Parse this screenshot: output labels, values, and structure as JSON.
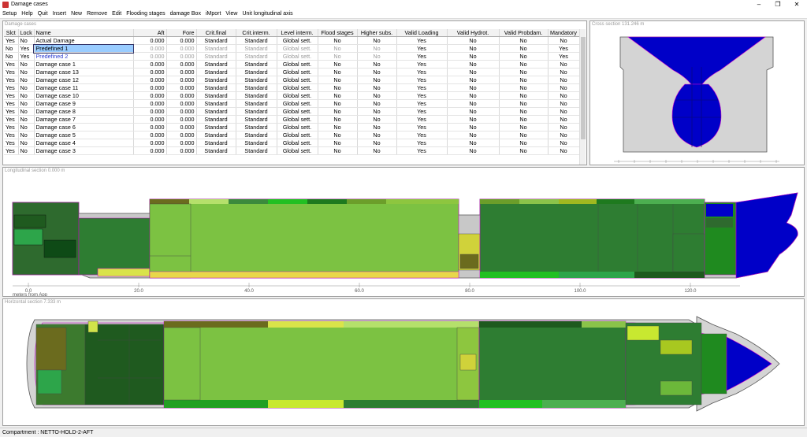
{
  "window": {
    "title": "Damage cases"
  },
  "menu": [
    "Setup",
    "Help",
    "Quit",
    "Insert",
    "New",
    "Remove",
    "Edit",
    "Flooding stages",
    "damage Box",
    "iMport",
    "View",
    "Unit longitudinal axis"
  ],
  "panels": {
    "damage_cases": "Damage cases",
    "cross_section": "Cross section 131.246 m",
    "longitudinal": "Longitudinal section 0.000 m",
    "horizontal": "Horizontal section 7.333 m"
  },
  "table": {
    "headers": [
      "Slct",
      "Lock",
      "Name",
      "Aft",
      "Fore",
      "Crit.final",
      "Crit.interm.",
      "Level interm.",
      "Flood stages",
      "Higher subs.",
      "Valid Loading",
      "Valid Hydrot.",
      "Valid Probdam.",
      "Mandatory"
    ],
    "rows": [
      [
        "Yes",
        "No",
        "Actual Damage",
        "0.000",
        "0.000",
        "Standard",
        "Standard",
        "Global sett.",
        "No",
        "No",
        "Yes",
        "No",
        "No",
        "No"
      ],
      [
        "No",
        "Yes",
        "Predefined 1",
        "0.000",
        "0.000",
        "Standard",
        "Standard",
        "Global sett.",
        "No",
        "No",
        "Yes",
        "No",
        "No",
        "Yes"
      ],
      [
        "No",
        "Yes",
        "Predefined 2",
        "0.000",
        "0.000",
        "Standard",
        "Standard",
        "Global sett.",
        "No",
        "No",
        "Yes",
        "No",
        "No",
        "Yes"
      ],
      [
        "Yes",
        "No",
        "Damage case 1",
        "0.000",
        "0.000",
        "Standard",
        "Standard",
        "Global sett.",
        "No",
        "No",
        "Yes",
        "No",
        "No",
        "No"
      ],
      [
        "Yes",
        "No",
        "Damage case 13",
        "0.000",
        "0.000",
        "Standard",
        "Standard",
        "Global sett.",
        "No",
        "No",
        "Yes",
        "No",
        "No",
        "No"
      ],
      [
        "Yes",
        "No",
        "Damage case 12",
        "0.000",
        "0.000",
        "Standard",
        "Standard",
        "Global sett.",
        "No",
        "No",
        "Yes",
        "No",
        "No",
        "No"
      ],
      [
        "Yes",
        "No",
        "Damage case 11",
        "0.000",
        "0.000",
        "Standard",
        "Standard",
        "Global sett.",
        "No",
        "No",
        "Yes",
        "No",
        "No",
        "No"
      ],
      [
        "Yes",
        "No",
        "Damage case 10",
        "0.000",
        "0.000",
        "Standard",
        "Standard",
        "Global sett.",
        "No",
        "No",
        "Yes",
        "No",
        "No",
        "No"
      ],
      [
        "Yes",
        "No",
        "Damage case 9",
        "0.000",
        "0.000",
        "Standard",
        "Standard",
        "Global sett.",
        "No",
        "No",
        "Yes",
        "No",
        "No",
        "No"
      ],
      [
        "Yes",
        "No",
        "Damage case 8",
        "0.000",
        "0.000",
        "Standard",
        "Standard",
        "Global sett.",
        "No",
        "No",
        "Yes",
        "No",
        "No",
        "No"
      ],
      [
        "Yes",
        "No",
        "Damage case 7",
        "0.000",
        "0.000",
        "Standard",
        "Standard",
        "Global sett.",
        "No",
        "No",
        "Yes",
        "No",
        "No",
        "No"
      ],
      [
        "Yes",
        "No",
        "Damage case 6",
        "0.000",
        "0.000",
        "Standard",
        "Standard",
        "Global sett.",
        "No",
        "No",
        "Yes",
        "No",
        "No",
        "No"
      ],
      [
        "Yes",
        "No",
        "Damage case 5",
        "0.000",
        "0.000",
        "Standard",
        "Standard",
        "Global sett.",
        "No",
        "No",
        "Yes",
        "No",
        "No",
        "No"
      ],
      [
        "Yes",
        "No",
        "Damage case 4",
        "0.000",
        "0.000",
        "Standard",
        "Standard",
        "Global sett.",
        "No",
        "No",
        "Yes",
        "No",
        "No",
        "No"
      ],
      [
        "Yes",
        "No",
        "Damage case 3",
        "0.000",
        "0.000",
        "Standard",
        "Standard",
        "Global sett.",
        "No",
        "No",
        "Yes",
        "No",
        "No",
        "No"
      ]
    ]
  },
  "long_axis": {
    "ticks": [
      "0.0",
      "20.0",
      "40.0",
      "60.0",
      "80.0",
      "100.0",
      "120.0"
    ],
    "label": "meters from App"
  },
  "status": "Compartment : NETTO-HOLD-2-AFT",
  "colors": {
    "selection": "#99ccff",
    "flooded_dark": "#2e7d32",
    "flooded_light": "#7cc242",
    "bow": "#0000cc",
    "hull": "#d8d8d8",
    "outline": "#cc00cc"
  }
}
